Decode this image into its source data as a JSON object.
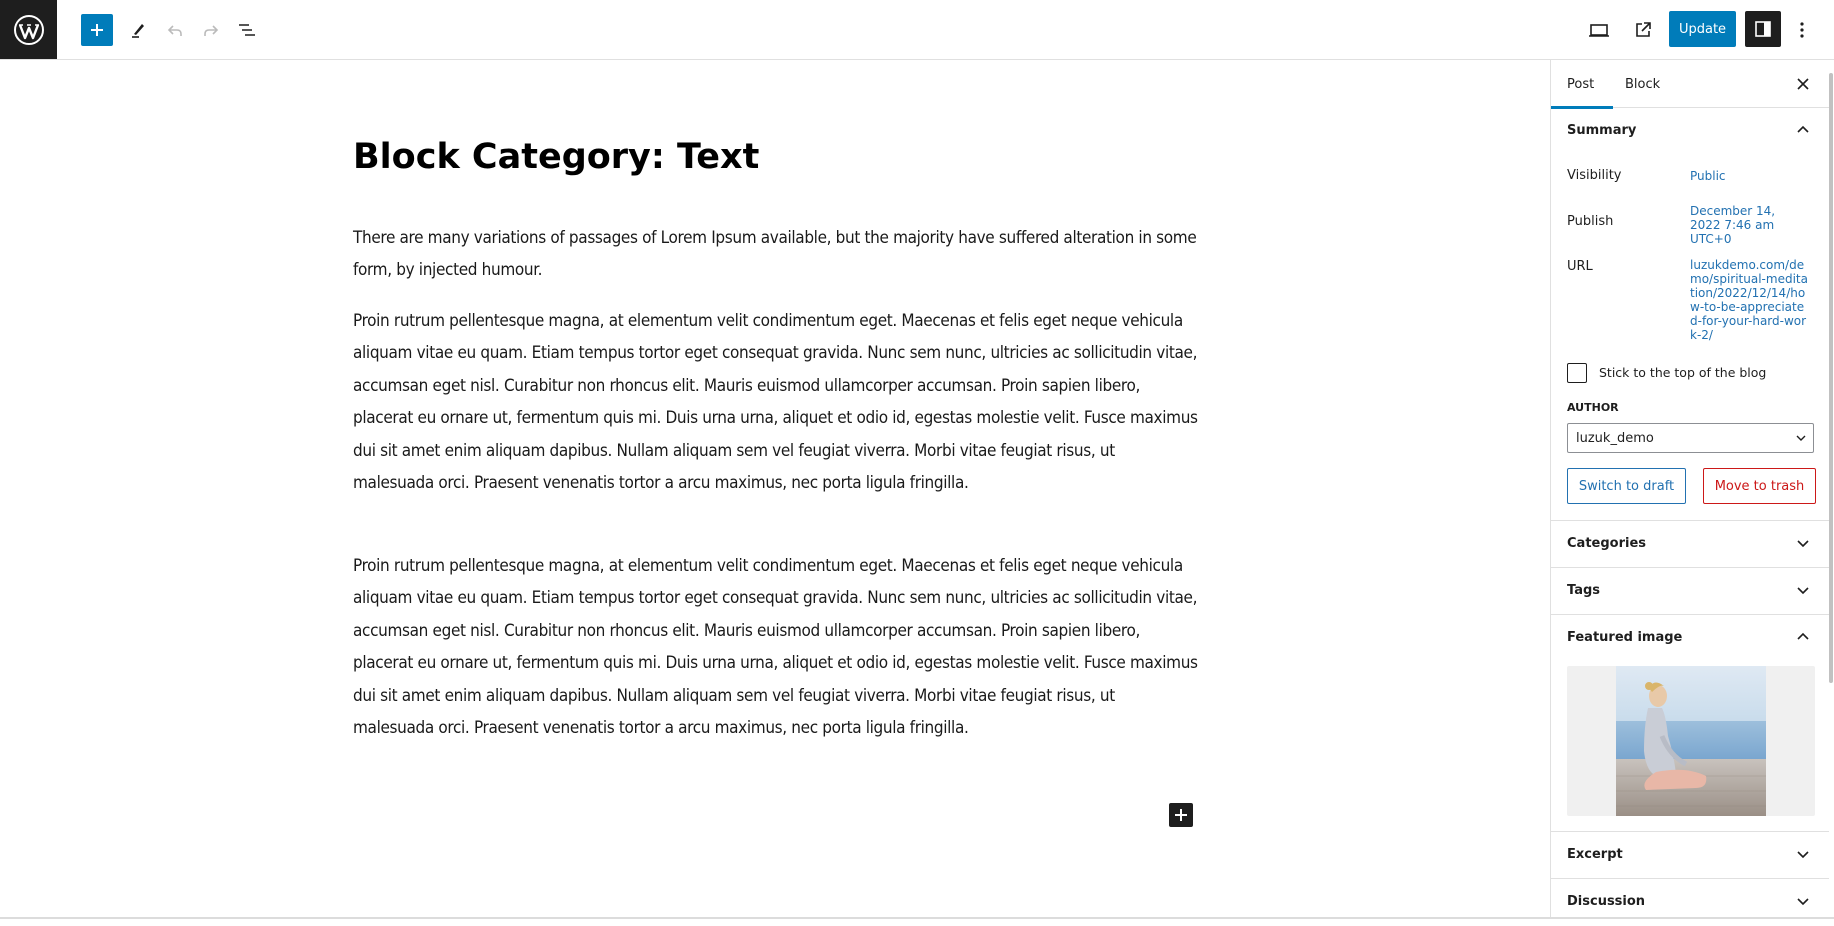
{
  "toolbar": {
    "logo": "wordpress-logo",
    "icons": {
      "inserter": "plus-icon",
      "tools": "pencil-icon",
      "undo": "undo-icon",
      "redo": "redo-icon",
      "list_view": "list-view-icon",
      "view": "desktop-view-icon",
      "preview": "external-link-icon",
      "settings": "sidebar-toggle-icon",
      "options": "more-vertical-icon"
    },
    "update_label": "Update"
  },
  "post": {
    "title": "Block Category: Text",
    "paragraphs": [
      "There are many variations of passages of Lorem Ipsum available, but the majority have suffered alteration in some form, by injected humour.",
      "Proin rutrum pellentesque magna, at elementum velit condimentum eget. Maecenas et felis eget neque vehicula aliquam vitae eu quam. Etiam tempus tortor eget consequat gravida. Nunc sem nunc, ultricies ac sollicitudin vitae, accumsan eget nisl. Curabitur non rhoncus elit. Mauris euismod ullamcorper accumsan. Proin sapien libero, placerat eu ornare ut, fermentum quis mi. Duis urna urna, aliquet et odio id, egestas molestie velit. Fusce maximus dui sit amet enim aliquam dapibus. Nullam aliquam sem vel feugiat viverra. Morbi vitae feugiat risus, ut malesuada orci. Praesent venenatis tortor a arcu maximus, nec porta ligula fringilla.",
      "Proin rutrum pellentesque magna, at elementum velit condimentum eget. Maecenas et felis eget neque vehicula aliquam vitae eu quam. Etiam tempus tortor eget consequat gravida. Nunc sem nunc, ultricies ac sollicitudin vitae, accumsan eget nisl. Curabitur non rhoncus elit. Mauris euismod ullamcorper accumsan. Proin sapien libero, placerat eu ornare ut, fermentum quis mi. Duis urna urna, aliquet et odio id, egestas molestie velit. Fusce maximus dui sit amet enim aliquam dapibus. Nullam aliquam sem vel feugiat viverra. Morbi vitae feugiat risus, ut malesuada orci. Praesent venenatis tortor a arcu maximus, nec porta ligula fringilla."
    ]
  },
  "sidebar": {
    "tabs": [
      {
        "label": "Post",
        "active": true
      },
      {
        "label": "Block",
        "active": false
      }
    ],
    "summary": {
      "title": "Summary",
      "visibility_label": "Visibility",
      "visibility_value": "Public",
      "publish_label": "Publish",
      "publish_value": "December 14, 2022 7:46 am UTC+0",
      "url_label": "URL",
      "url_value": "luzukdemo.com/demo/spiritual-meditation/2022/12/14/how-to-be-appreciated-for-your-hard-work-2/",
      "sticky_label": "Stick to the top of the blog",
      "sticky_checked": false,
      "author_label": "AUTHOR",
      "author_value": "luzuk_demo",
      "switch_draft_label": "Switch to draft",
      "move_trash_label": "Move to trash"
    },
    "panels": {
      "categories": "Categories",
      "tags": "Tags",
      "featured_image": "Featured image",
      "excerpt": "Excerpt",
      "discussion": "Discussion"
    },
    "colors": {
      "accent": "#007cba",
      "link": "#2271b1",
      "danger": "#cc1818",
      "dark": "#1e1e1e"
    }
  }
}
